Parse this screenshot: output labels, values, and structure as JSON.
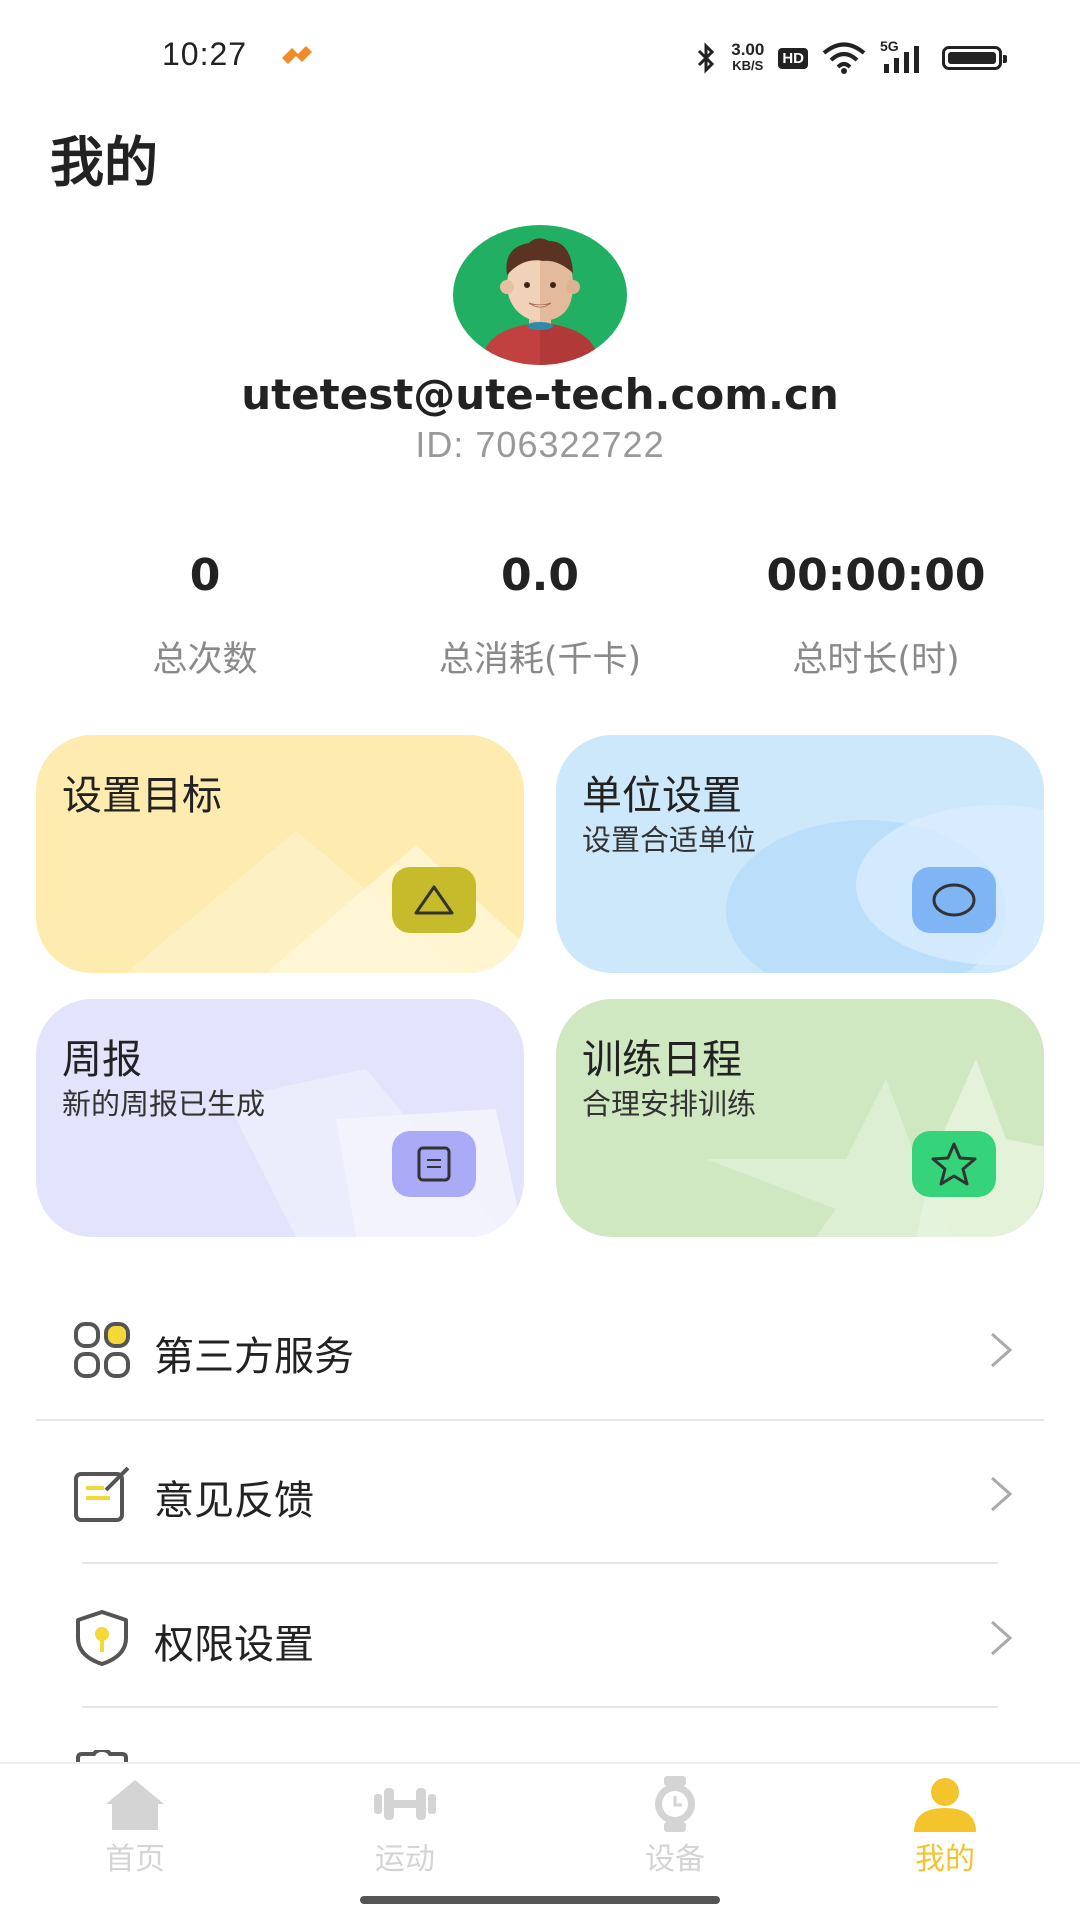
{
  "status_bar": {
    "time": "10:27",
    "speed_value": "3.00",
    "speed_unit": "KB/S",
    "hd": "HD",
    "network": "5G",
    "icons": [
      "app-icon",
      "bluetooth-icon",
      "wifi-icon",
      "signal-icon",
      "battery-icon"
    ]
  },
  "header": {
    "title": "我的"
  },
  "profile": {
    "avatar": "avatar-icon",
    "email": "utetest@ute-tech.com.cn",
    "id": "ID: 706322722"
  },
  "stats": [
    {
      "value": "0",
      "label": "总次数"
    },
    {
      "value": "0.0",
      "label": "总消耗(千卡)"
    },
    {
      "value": "00:00:00",
      "label": "总时长(时)"
    }
  ],
  "cards": {
    "goal": {
      "title": "设置目标",
      "subtitle": "",
      "icon": "triangle-icon",
      "color": "#fdebb0",
      "button_color": "#c6bb2a"
    },
    "unit": {
      "title": "单位设置",
      "subtitle": "设置合适单位",
      "icon": "circle-icon",
      "color": "#cde8fb",
      "button_color": "#7fb5f5"
    },
    "report": {
      "title": "周报",
      "subtitle": "新的周报已生成",
      "icon": "report-icon",
      "color": "#e3e4fb",
      "button_color": "#aaaaf6"
    },
    "schedule": {
      "title": "训练日程",
      "subtitle": "合理安排训练",
      "icon": "star-icon",
      "color": "#cfe8c2",
      "button_color": "#35d47a"
    }
  },
  "menu": [
    {
      "label": "第三方服务",
      "icon": "apps-icon"
    },
    {
      "label": "意见反馈",
      "icon": "feedback-icon"
    },
    {
      "label": "权限设置",
      "icon": "shield-key-icon"
    }
  ],
  "bottom_nav": [
    {
      "label": "首页",
      "icon": "home-icon",
      "active": false
    },
    {
      "label": "运动",
      "icon": "dumbbell-icon",
      "active": false
    },
    {
      "label": "设备",
      "icon": "watch-icon",
      "active": false
    },
    {
      "label": "我的",
      "icon": "person-icon",
      "active": true
    }
  ],
  "colors": {
    "accent": "#f3c42b",
    "inactive": "#d4d4d4"
  }
}
